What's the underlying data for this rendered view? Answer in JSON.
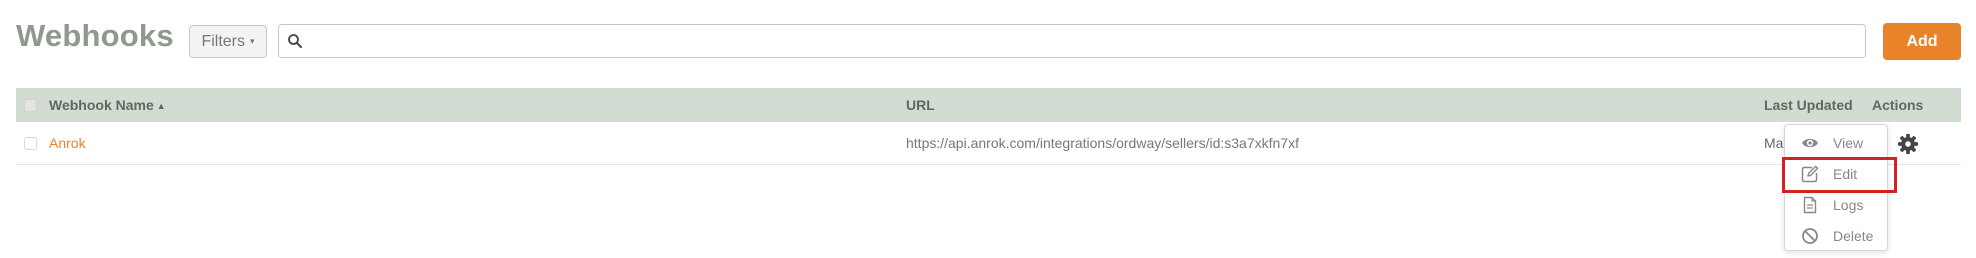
{
  "header": {
    "title": "Webhooks",
    "filters_label": "Filters",
    "search": {
      "value": "",
      "placeholder": ""
    },
    "add_label": "Add"
  },
  "table": {
    "columns": {
      "name": "Webhook Name",
      "url": "URL",
      "last_updated": "Last Updated",
      "actions": "Actions"
    },
    "rows": [
      {
        "name": "Anrok",
        "url": "https://api.anrok.com/integrations/ordway/sellers/id:s3a7xkfn7xf",
        "last_updated": "Ma"
      }
    ]
  },
  "actions_menu": {
    "items": [
      {
        "label": "View",
        "icon": "eye-icon"
      },
      {
        "label": "Edit",
        "icon": "edit-icon"
      },
      {
        "label": "Logs",
        "icon": "document-icon"
      },
      {
        "label": "Delete",
        "icon": "ban-icon"
      }
    ],
    "highlighted": "Edit"
  },
  "colors": {
    "title": "#8f9a8f",
    "accent": "#e8832a",
    "table_header_bg": "#d3dcd3",
    "highlight_border": "#d32222"
  }
}
